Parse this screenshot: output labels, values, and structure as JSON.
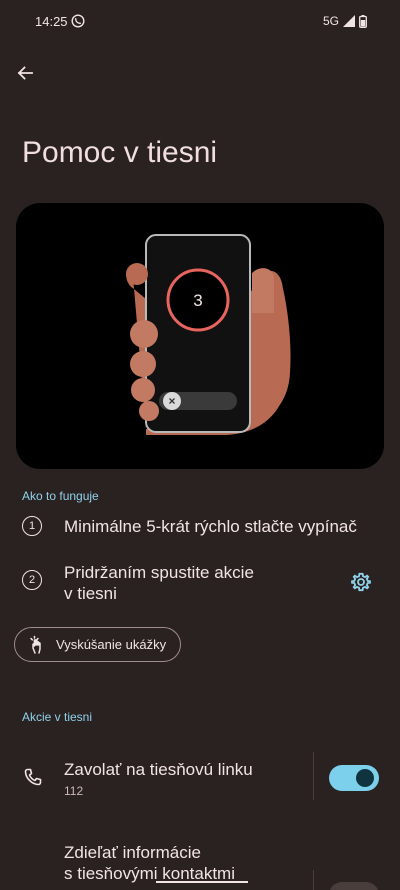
{
  "status_bar": {
    "time": "14:25",
    "network": "5G"
  },
  "page": {
    "title": "Pomoc v tiesni"
  },
  "illustration": {
    "countdown": "3"
  },
  "how_it_works": {
    "header": "Ako to funguje",
    "steps": [
      {
        "number": "1",
        "text": "Minimálne 5-krát rýchlo stlačte vypínač"
      },
      {
        "number": "2",
        "text_line1": "Pridržaním spustite akcie",
        "text_line2": "v tiesni"
      }
    ],
    "demo_button": "Vyskúšanie ukážky"
  },
  "emergency_actions": {
    "header": "Akcie v tiesni",
    "items": [
      {
        "title": "Zavolať na tiesňovú linku",
        "subtitle": "112",
        "enabled": true
      },
      {
        "title_line1": "Zdieľať informácie",
        "title_line2": "s tiesňovými kontaktmi",
        "enabled": false
      }
    ]
  },
  "colors": {
    "background": "#2a2121",
    "accent": "#7dd0ec",
    "section_header": "#8fd3ec",
    "countdown_ring": "#e8645f",
    "hand": "#b86a52"
  }
}
